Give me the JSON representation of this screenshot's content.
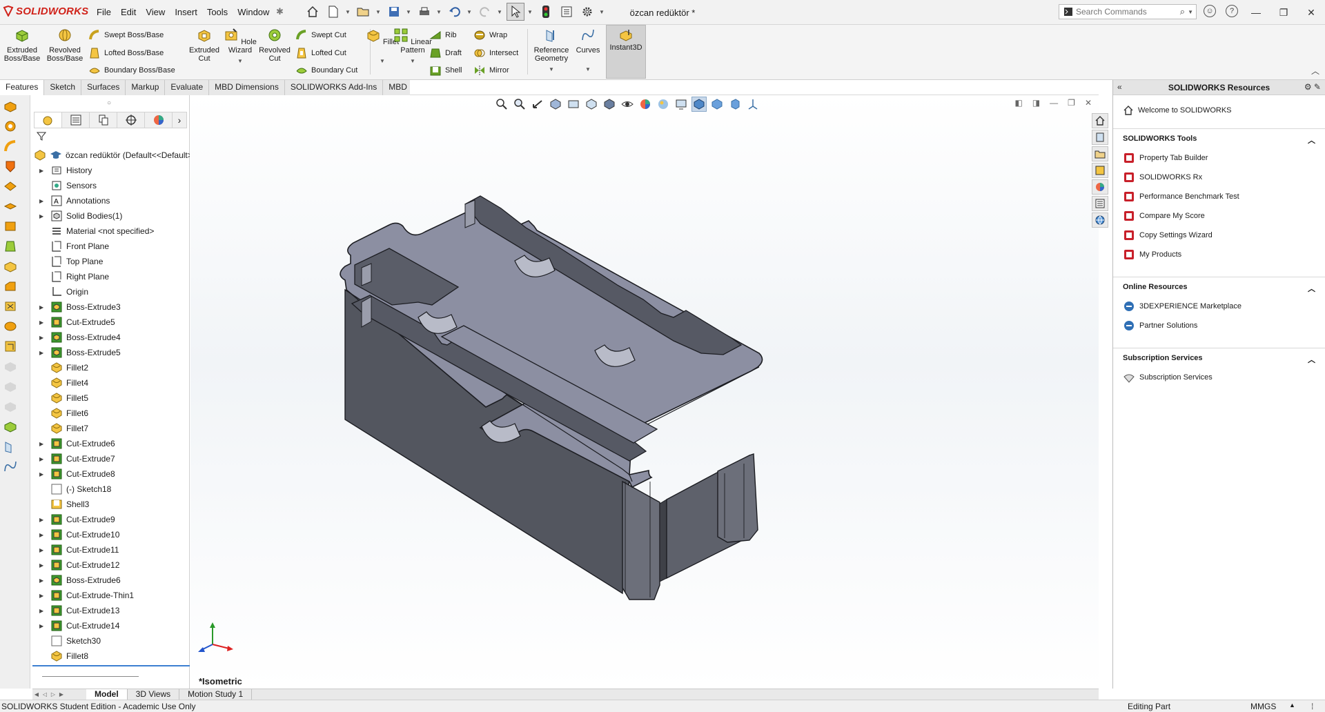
{
  "app": {
    "name": "SOLIDWORKS",
    "document_title": "özcan redüktör *"
  },
  "menu": [
    "File",
    "Edit",
    "View",
    "Insert",
    "Tools",
    "Window"
  ],
  "search": {
    "placeholder": "Search Commands"
  },
  "commands": {
    "extruded_boss": "Extruded Boss/Base",
    "revolved_boss": "Revolved Boss/Base",
    "swept_boss": "Swept Boss/Base",
    "lofted_boss": "Lofted Boss/Base",
    "boundary_boss": "Boundary Boss/Base",
    "extruded_cut": "Extruded Cut",
    "hole_wizard": "Hole Wizard",
    "revolved_cut": "Revolved Cut",
    "swept_cut": "Swept Cut",
    "lofted_cut": "Lofted Cut",
    "boundary_cut": "Boundary Cut",
    "fillet": "Fillet",
    "linear_pattern": "Linear Pattern",
    "rib": "Rib",
    "draft": "Draft",
    "shell": "Shell",
    "wrap": "Wrap",
    "intersect": "Intersect",
    "mirror": "Mirror",
    "reference_geometry": "Reference Geometry",
    "curves": "Curves",
    "instant3d": "Instant3D"
  },
  "tabs": [
    "Features",
    "Sketch",
    "Surfaces",
    "Markup",
    "Evaluate",
    "MBD Dimensions",
    "SOLIDWORKS Add-Ins",
    "MBD"
  ],
  "tree": {
    "root": "özcan redüktör  (Default<<Default>_Display State 1>)",
    "nodes": [
      {
        "label": "History",
        "expandable": true,
        "icon": "history"
      },
      {
        "label": "Sensors",
        "expandable": false,
        "icon": "sensor"
      },
      {
        "label": "Annotations",
        "expandable": true,
        "icon": "annotation"
      },
      {
        "label": "Solid Bodies(1)",
        "expandable": true,
        "icon": "solid"
      },
      {
        "label": "Material <not specified>",
        "expandable": false,
        "icon": "material"
      },
      {
        "label": "Front Plane",
        "expandable": false,
        "icon": "plane"
      },
      {
        "label": "Top Plane",
        "expandable": false,
        "icon": "plane"
      },
      {
        "label": "Right Plane",
        "expandable": false,
        "icon": "plane"
      },
      {
        "label": "Origin",
        "expandable": false,
        "icon": "origin"
      },
      {
        "label": "Boss-Extrude3",
        "expandable": true,
        "icon": "boss"
      },
      {
        "label": "Cut-Extrude5",
        "expandable": true,
        "icon": "cut"
      },
      {
        "label": "Boss-Extrude4",
        "expandable": true,
        "icon": "boss"
      },
      {
        "label": "Boss-Extrude5",
        "expandable": true,
        "icon": "boss"
      },
      {
        "label": "Fillet2",
        "expandable": false,
        "icon": "fillet"
      },
      {
        "label": "Fillet4",
        "expandable": false,
        "icon": "fillet"
      },
      {
        "label": "Fillet5",
        "expandable": false,
        "icon": "fillet"
      },
      {
        "label": "Fillet6",
        "expandable": false,
        "icon": "fillet"
      },
      {
        "label": "Fillet7",
        "expandable": false,
        "icon": "fillet"
      },
      {
        "label": "Cut-Extrude6",
        "expandable": true,
        "icon": "cut"
      },
      {
        "label": "Cut-Extrude7",
        "expandable": true,
        "icon": "cut"
      },
      {
        "label": "Cut-Extrude8",
        "expandable": true,
        "icon": "cut"
      },
      {
        "label": "(-) Sketch18",
        "expandable": false,
        "icon": "sketch"
      },
      {
        "label": "Shell3",
        "expandable": false,
        "icon": "shell"
      },
      {
        "label": "Cut-Extrude9",
        "expandable": true,
        "icon": "cut"
      },
      {
        "label": "Cut-Extrude10",
        "expandable": true,
        "icon": "cut"
      },
      {
        "label": "Cut-Extrude11",
        "expandable": true,
        "icon": "cut"
      },
      {
        "label": "Cut-Extrude12",
        "expandable": true,
        "icon": "cut"
      },
      {
        "label": "Boss-Extrude6",
        "expandable": true,
        "icon": "boss"
      },
      {
        "label": "Cut-Extrude-Thin1",
        "expandable": true,
        "icon": "cut"
      },
      {
        "label": "Cut-Extrude13",
        "expandable": true,
        "icon": "cut"
      },
      {
        "label": "Cut-Extrude14",
        "expandable": true,
        "icon": "cut"
      },
      {
        "label": "Sketch30",
        "expandable": false,
        "icon": "sketch"
      },
      {
        "label": "Fillet8",
        "expandable": false,
        "icon": "fillet"
      }
    ]
  },
  "viewport": {
    "view_name": "*Isometric"
  },
  "taskpane": {
    "title": "SOLIDWORKS Resources",
    "welcome": "Welcome to SOLIDWORKS",
    "sections": [
      {
        "title": "SOLIDWORKS Tools",
        "items": [
          "Property Tab Builder",
          "SOLIDWORKS Rx",
          "Performance Benchmark Test",
          "Compare My Score",
          "Copy Settings Wizard",
          "My Products"
        ]
      },
      {
        "title": "Online Resources",
        "items": [
          "3DEXPERIENCE Marketplace",
          "Partner Solutions"
        ]
      },
      {
        "title": "Subscription Services",
        "items": [
          "Subscription Services"
        ]
      }
    ]
  },
  "bottom_tabs": [
    "Model",
    "3D Views",
    "Motion Study 1"
  ],
  "status": {
    "edition": "SOLIDWORKS Student Edition - Academic Use Only",
    "mode": "Editing Part",
    "units": "MMGS"
  },
  "colors": {
    "brand": "#d0221a",
    "part": "#8c8fa2",
    "accent": "#3b7fd1"
  }
}
